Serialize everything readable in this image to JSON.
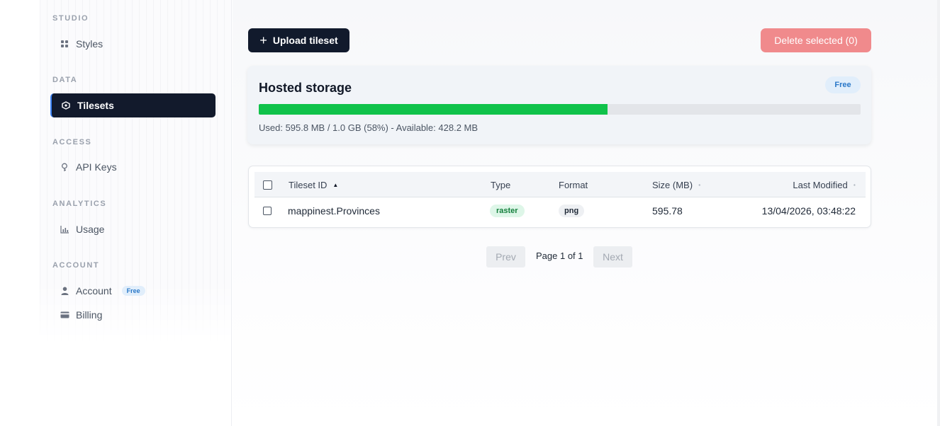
{
  "sidebar": {
    "sections": [
      {
        "title": "STUDIO"
      },
      {
        "title": "DATA"
      },
      {
        "title": "ACCESS"
      },
      {
        "title": "ANALYTICS"
      },
      {
        "title": "ACCOUNT"
      }
    ],
    "items": {
      "styles": {
        "label": "Styles",
        "icon": "grid-icon"
      },
      "tilesets": {
        "label": "Tilesets",
        "icon": "tileset-icon",
        "active": true
      },
      "api_keys": {
        "label": "API Keys",
        "icon": "key-icon"
      },
      "usage": {
        "label": "Usage",
        "icon": "chart-icon"
      },
      "account": {
        "label": "Account",
        "icon": "user-icon",
        "badge": "Free"
      },
      "billing": {
        "label": "Billing",
        "icon": "card-icon"
      }
    }
  },
  "toolbar": {
    "upload_label": "Upload tileset",
    "delete_label": "Delete selected (0)"
  },
  "storage": {
    "title": "Hosted storage",
    "plan_badge": "Free",
    "used_fraction": 0.58,
    "summary": "Used: 595.8 MB / 1.0 GB (58%) - Available: 428.2 MB",
    "bar_color": "#10c24a"
  },
  "table": {
    "columns": {
      "id": "Tileset ID",
      "type": "Type",
      "format": "Format",
      "size": "Size (MB)",
      "modified": "Last Modified"
    },
    "rows": [
      {
        "id": "mappinest.Provinces",
        "type": "raster",
        "format": "png",
        "size": "595.78",
        "modified": "13/04/2026, 03:48:22"
      }
    ]
  },
  "pagination": {
    "prev": "Prev",
    "page_text": "Page 1 of 1",
    "next": "Next"
  },
  "colors": {
    "primary_dark": "#111a2c",
    "danger": "#f08a8c",
    "accent_blue": "#2a78c8"
  }
}
